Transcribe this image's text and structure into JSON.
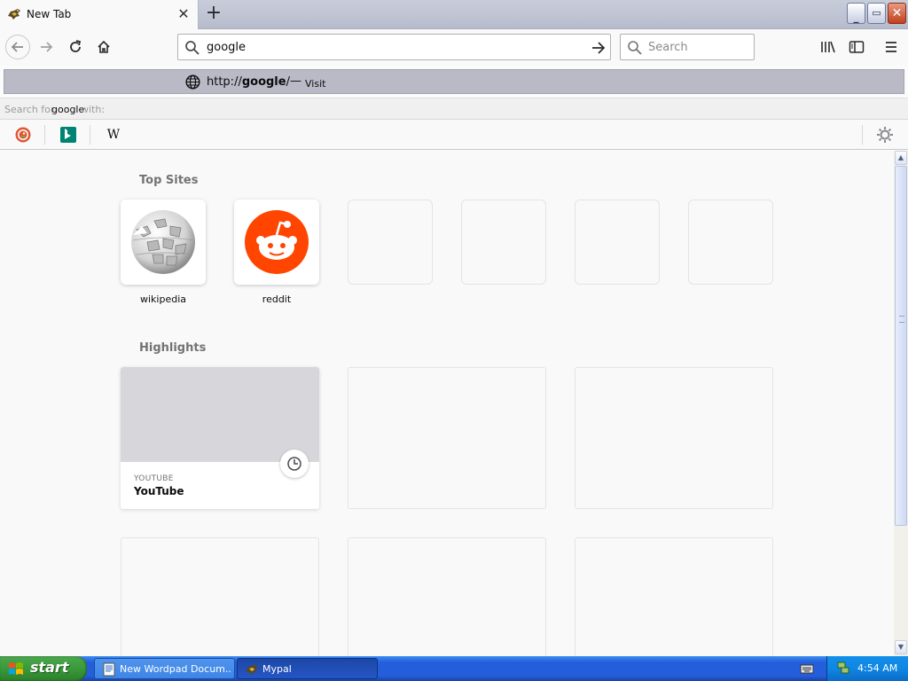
{
  "browser": {
    "tab": {
      "title": "New Tab",
      "close_glyph": "✕"
    },
    "new_tab_glyph": "+",
    "window_buttons": {
      "minimize": "_",
      "restore": "▭",
      "close": "✕"
    },
    "urlbar": {
      "value": "google"
    },
    "searchbar": {
      "placeholder": "Search"
    },
    "dropdown": {
      "result": {
        "url_prefix": "http://",
        "url_domain": "google",
        "url_suffix": "/",
        "separator": "—",
        "action": "Visit"
      },
      "search_with": {
        "prefix": "Search for ",
        "query": "google",
        "suffix": " with:"
      },
      "engines": [
        {
          "name": "DuckDuckGo",
          "icon": "duckduckgo-icon"
        },
        {
          "name": "Bing",
          "icon": "bing-icon"
        },
        {
          "name": "Wikipedia",
          "icon": "wikipedia-icon",
          "glyph": "W"
        }
      ]
    }
  },
  "newtab": {
    "top_sites_title": "Top Sites",
    "top_sites": [
      {
        "label": "wikipedia",
        "icon": "wikipedia-globe-icon"
      },
      {
        "label": "reddit",
        "icon": "reddit-icon"
      }
    ],
    "highlights_title": "Highlights",
    "highlights": [
      {
        "host": "YOUTUBE",
        "title": "YouTube",
        "badge": "clock-icon"
      }
    ]
  },
  "taskbar": {
    "start_label": "start",
    "tasks": [
      {
        "label": "New Wordpad Docum...",
        "icon": "wordpad-icon",
        "active": false
      },
      {
        "label": "Mypal",
        "icon": "mypal-icon",
        "active": true
      }
    ],
    "clock": "4:54 AM"
  },
  "colors": {
    "reddit_orange": "#ff4500",
    "taskbar_blue": "#245edb",
    "start_green": "#3a9a3a",
    "bing_teal": "#008373",
    "selected_row": "#b9bac6"
  }
}
